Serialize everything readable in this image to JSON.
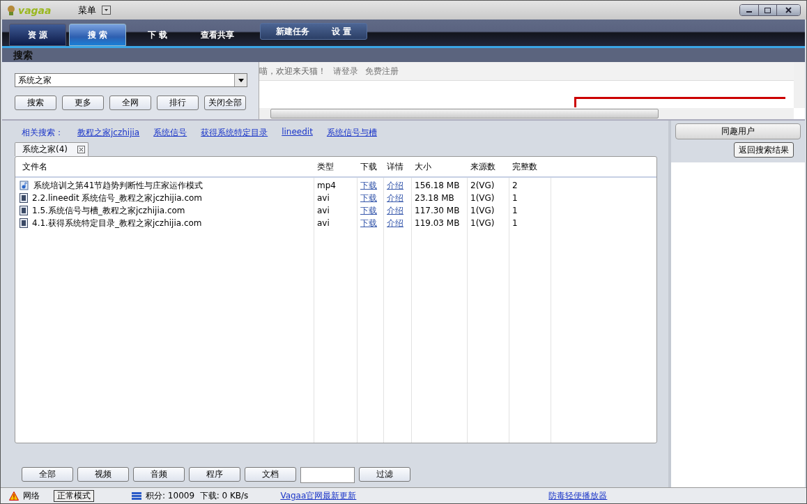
{
  "window": {
    "logo": "vagaa",
    "menu": "菜单"
  },
  "nav": {
    "tabs": [
      {
        "label": "资 源",
        "selected": false
      },
      {
        "label": "搜 索",
        "selected": true
      },
      {
        "label": "下 载",
        "selected": false
      },
      {
        "label": "查看共享",
        "selected": false
      }
    ],
    "actions": [
      "新建任务",
      "设 置"
    ]
  },
  "section_title": "搜索",
  "search": {
    "value": "系统之家",
    "buttons": [
      "搜索",
      "更多",
      "全网",
      "排行",
      "关闭全部"
    ]
  },
  "web_view": {
    "greeting": "喵，欢迎来天猫！",
    "links": [
      "请登录",
      "免费注册"
    ]
  },
  "related": {
    "label": "相关搜索：",
    "links": [
      "教程之家jczhijia",
      "系统信号",
      "获得系统特定目录",
      "lineedit",
      "系统信号与槽"
    ]
  },
  "result_tab": {
    "label": "系统之家(4)"
  },
  "table": {
    "columns": [
      "文件名",
      "类型",
      "下载",
      "详情",
      "大小",
      "来源数",
      "完整数"
    ],
    "rows": [
      {
        "kind": "audio",
        "name": "系统培训之第41节趋势判断性与庄家运作模式",
        "type": "mp4",
        "download": "下载",
        "details": "介绍",
        "size": "156.18 MB",
        "sources": "2(VG)",
        "complete": "2"
      },
      {
        "kind": "video",
        "name": "2.2.lineedit 系统信号_教程之家jczhijia.com",
        "type": "avi",
        "download": "下载",
        "details": "介绍",
        "size": "23.18 MB",
        "sources": "1(VG)",
        "complete": "1"
      },
      {
        "kind": "video",
        "name": "1.5.系统信号与槽_教程之家jczhijia.com",
        "type": "avi",
        "download": "下载",
        "details": "介绍",
        "size": "117.30 MB",
        "sources": "1(VG)",
        "complete": "1"
      },
      {
        "kind": "video",
        "name": "4.1.获得系统特定目录_教程之家jczhijia.com",
        "type": "avi",
        "download": "下载",
        "details": "介绍",
        "size": "119.03 MB",
        "sources": "1(VG)",
        "complete": "1"
      }
    ]
  },
  "filters": {
    "buttons": [
      "全部",
      "视频",
      "音频",
      "程序",
      "文档"
    ],
    "apply": "过滤"
  },
  "side": {
    "buttons": [
      "同趣用户",
      "返回搜索结果"
    ]
  },
  "status_bar": {
    "network": "网络",
    "mode": "正常模式",
    "stats": "积分: 10009  下载: 0 KB/s",
    "links": [
      "Vagaa官网最新更新",
      "防毒轻便播放器"
    ]
  }
}
